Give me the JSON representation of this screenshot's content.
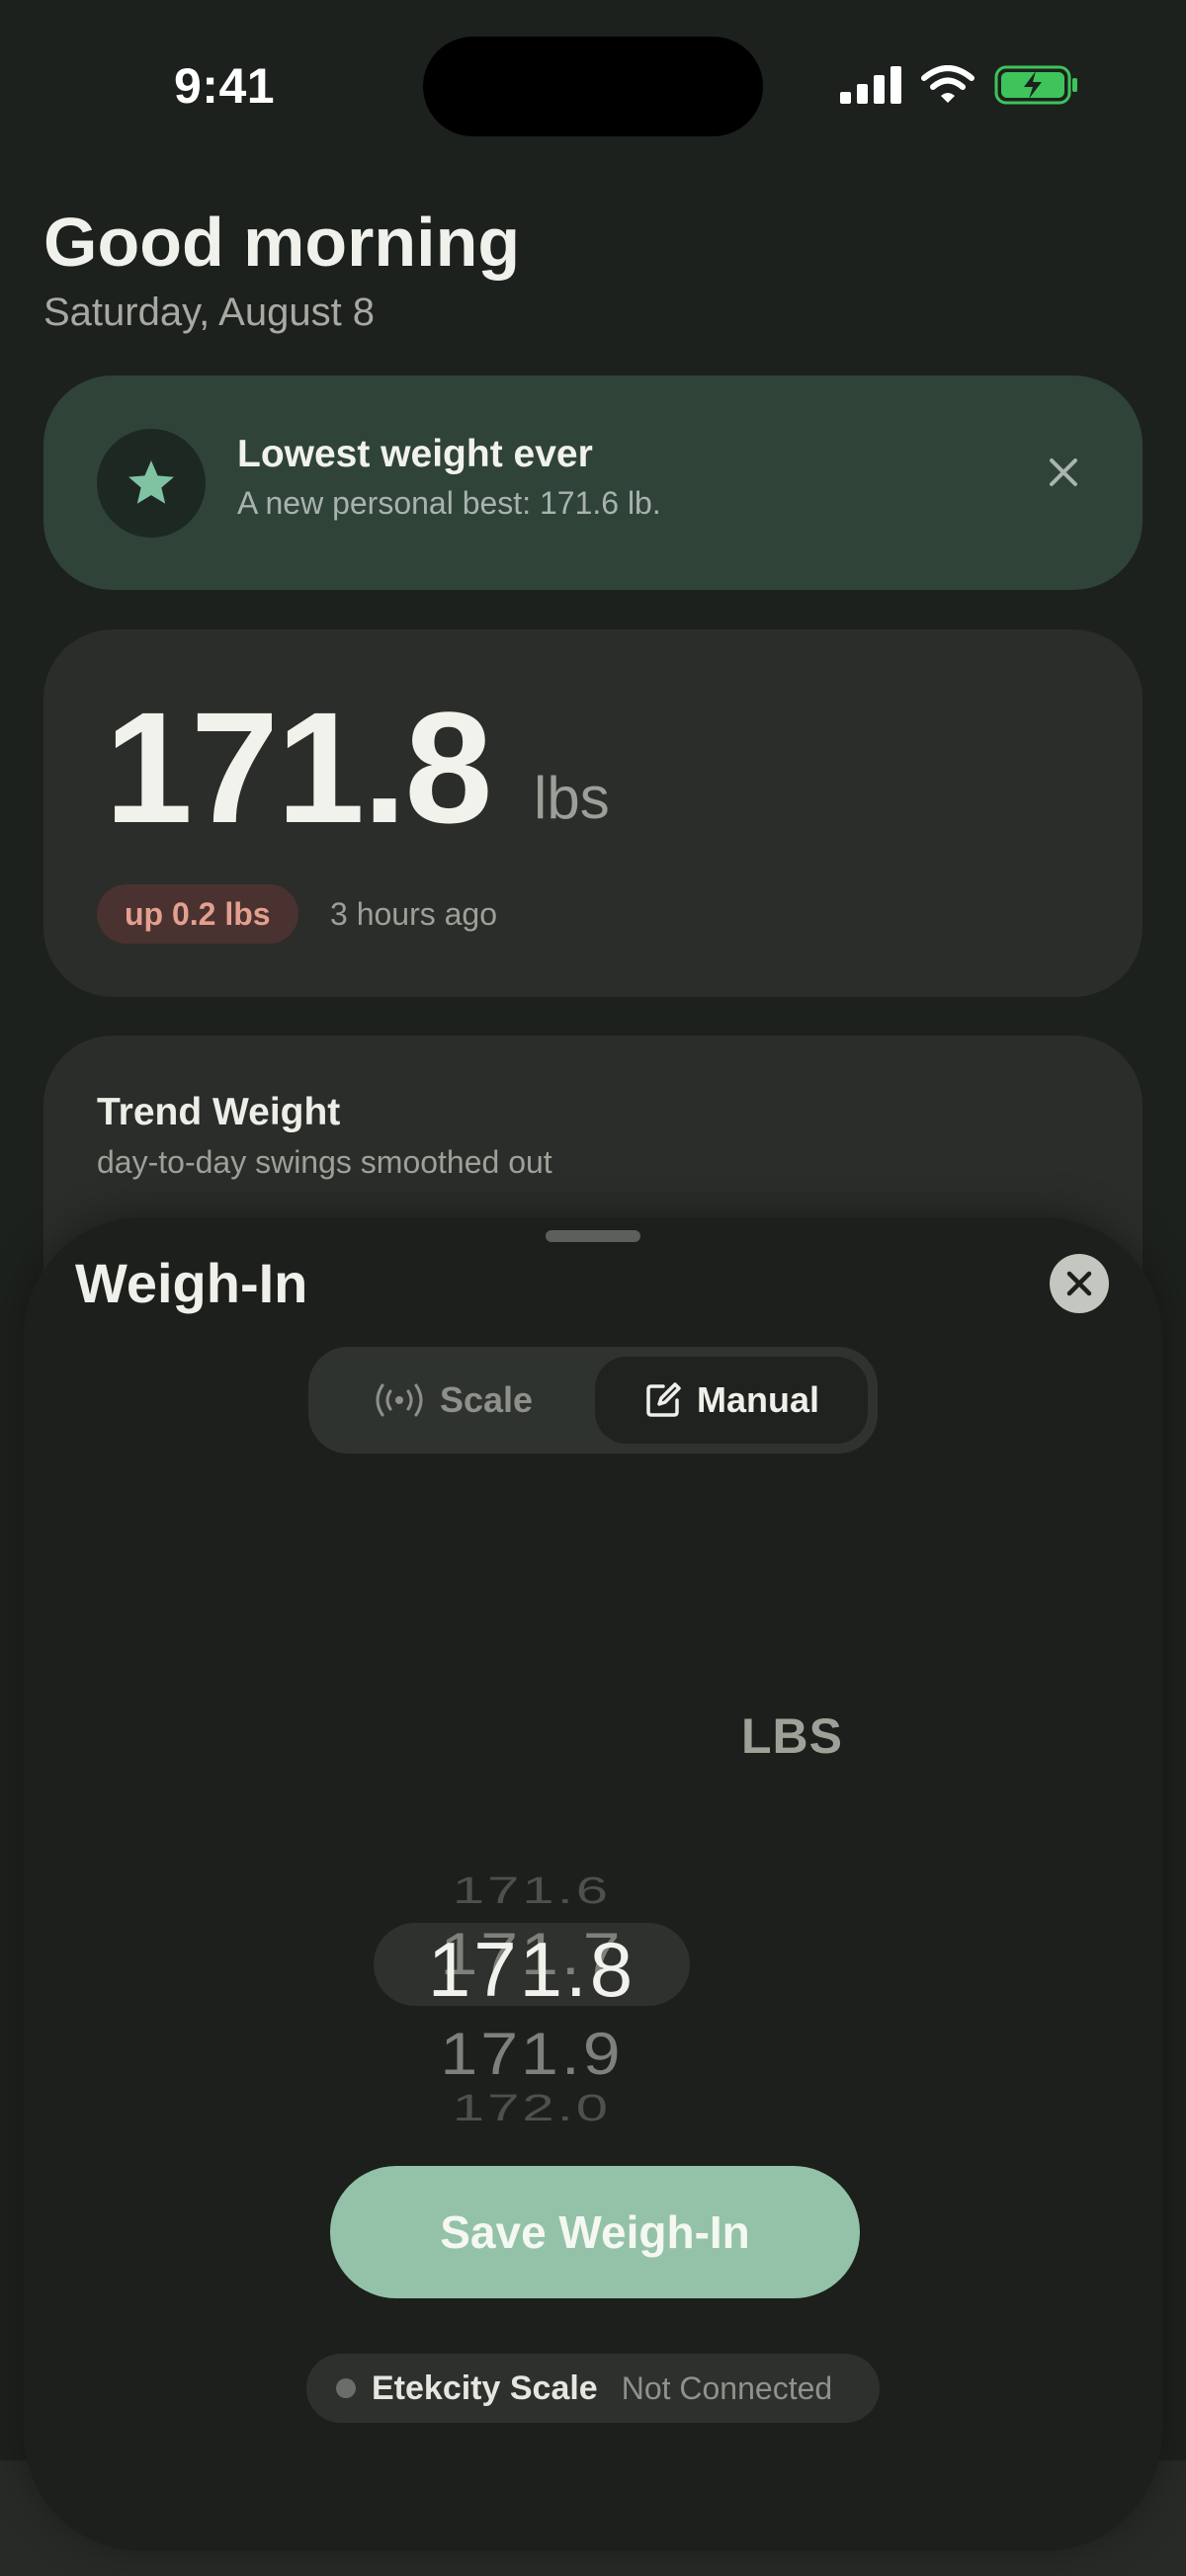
{
  "status_bar": {
    "time": "9:41",
    "battery_color": "#3ec45a"
  },
  "header": {
    "greeting": "Good morning",
    "date": "Saturday, August 8"
  },
  "achievement": {
    "title": "Lowest weight ever",
    "subtitle": "A new personal best: 171.6 lb.",
    "icon": "star-icon",
    "accent": "#7fc3a2"
  },
  "current_weight": {
    "value": "171.8",
    "unit": "lbs",
    "change": "up 0.2 lbs",
    "time_ago": "3 hours ago",
    "change_color": "#e3a08f"
  },
  "trend": {
    "title": "Trend Weight",
    "subtitle": "day-to-day swings smoothed out"
  },
  "sheet": {
    "title": "Weigh-In",
    "modes": [
      {
        "label": "Scale",
        "icon": "scale-signal-icon",
        "selected": false
      },
      {
        "label": "Manual",
        "icon": "edit-icon",
        "selected": true
      }
    ],
    "picker": {
      "values": [
        "171.6",
        "171.7",
        "171.8",
        "171.9",
        "172.0"
      ],
      "selected": "171.8",
      "unit": "LBS"
    },
    "save_label": "Save Weigh-In",
    "save_color": "#93c2a8",
    "connection": {
      "device": "Etekcity Scale",
      "status": "Not Connected"
    }
  }
}
